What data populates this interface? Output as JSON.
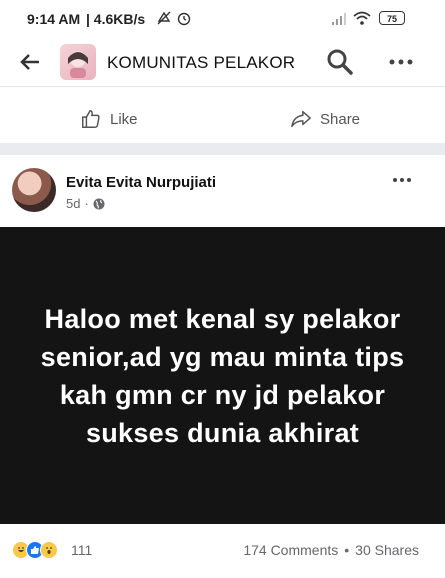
{
  "status_bar": {
    "time": "9:14 AM",
    "speed": "| 4.6KB/s",
    "battery": "75"
  },
  "app_bar": {
    "group_name": "KOMUNITAS PELAKOR"
  },
  "actions": {
    "like_label": "Like",
    "share_label": "Share"
  },
  "post": {
    "author": "Evita Evita Nurpujiati",
    "age": "5d",
    "separator": "·",
    "text": "Haloo met kenal sy pelakor senior,ad yg mau minta tips kah gmn cr ny jd pelakor sukses dunia akhirat",
    "background_color": "#141414",
    "reaction_count": "111",
    "comments": "174 Comments",
    "stats_separator": "•",
    "shares": "30 Shares"
  },
  "colors": {
    "accent": "#1877f2",
    "muted_text": "#65676b"
  }
}
